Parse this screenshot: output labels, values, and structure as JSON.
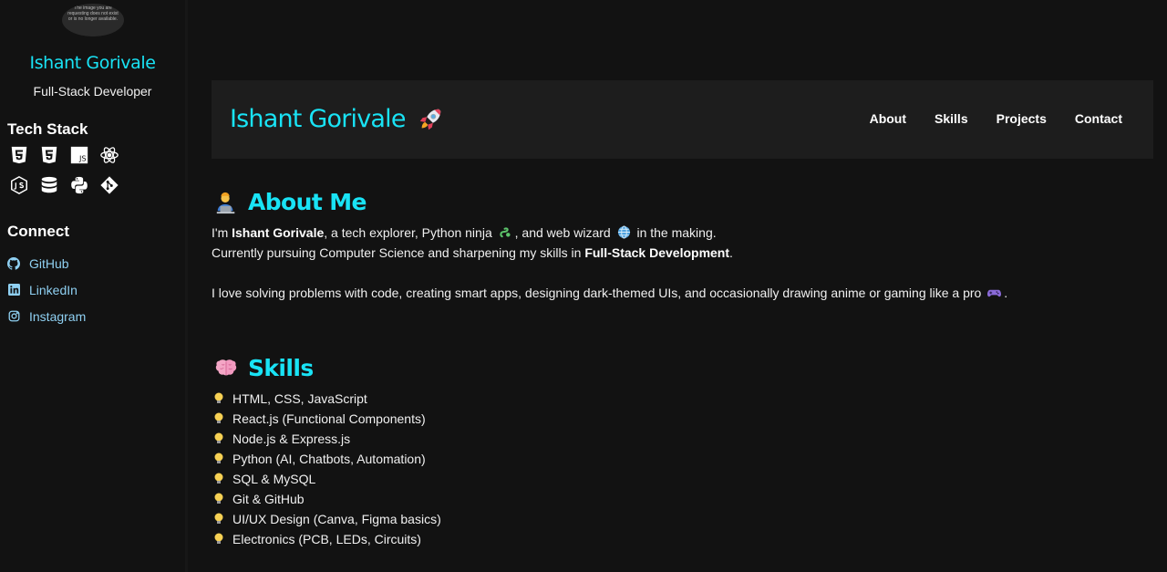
{
  "sidebar": {
    "avatar_alt_text": "The image you are requesting does not exist or is no longer available.",
    "name": "Ishant Gorivale",
    "role": "Full-Stack Developer",
    "tech_stack_heading": "Tech Stack",
    "tech_icons": [
      "html5-icon",
      "css3-icon",
      "javascript-icon",
      "react-icon",
      "nodejs-icon",
      "database-icon",
      "python-icon",
      "git-icon"
    ],
    "connect_heading": "Connect",
    "links": [
      {
        "label": "GitHub",
        "icon": "github-icon"
      },
      {
        "label": "LinkedIn",
        "icon": "linkedin-icon"
      },
      {
        "label": "Instagram",
        "icon": "instagram-icon"
      }
    ]
  },
  "header": {
    "brand": "Ishant Gorivale",
    "brand_icon": "rocket-icon",
    "nav": [
      "About",
      "Skills",
      "Projects",
      "Contact"
    ]
  },
  "about": {
    "title": "About Me",
    "title_icon": "technologist-icon",
    "line1_pre": "I'm ",
    "line1_name": "Ishant Gorivale",
    "line1_mid": ", a tech explorer, Python ninja ",
    "line1_mid2": ", and web wizard ",
    "line1_post": " in the making.",
    "line2_pre": "Currently pursuing Computer Science and sharpening my skills in ",
    "line2_bold": "Full-Stack Development",
    "line2_post": ".",
    "line3_pre": "I love solving problems with code, creating smart apps, designing dark-themed UIs, and occasionally drawing anime or gaming like a pro ",
    "line3_post": "."
  },
  "skills": {
    "title": "Skills",
    "title_icon": "brain-icon",
    "items": [
      "HTML, CSS, JavaScript",
      "React.js (Functional Components)",
      "Node.js & Express.js",
      "Python (AI, Chatbots, Automation)",
      "SQL & MySQL",
      "Git & GitHub",
      "UI/UX Design (Canva, Figma basics)",
      "Electronics (PCB, LEDs, Circuits)"
    ]
  },
  "colors": {
    "accent": "#19e3f5",
    "background": "#121212",
    "header_bg": "#1d1d1d",
    "link": "#8fd0f2"
  }
}
